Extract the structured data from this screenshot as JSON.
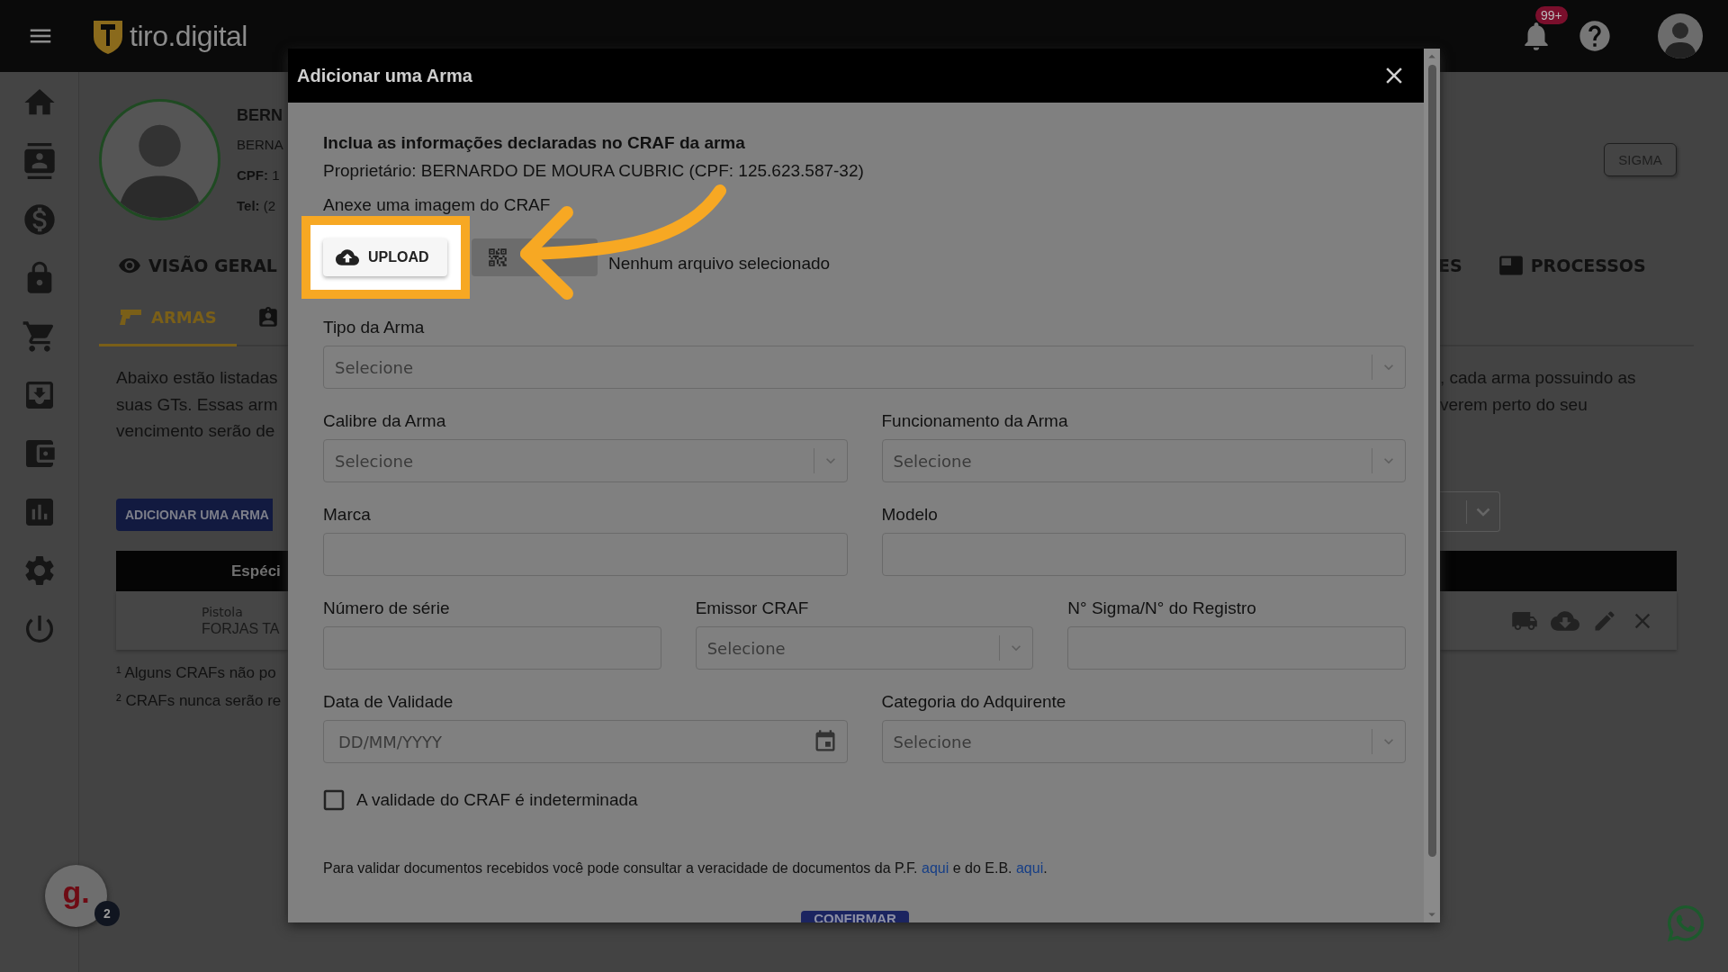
{
  "app": {
    "logo": "tiro.digital",
    "notifications_badge": "99+"
  },
  "profile": {
    "name": "BERN",
    "line_2": "BERNA",
    "cpf": "**CPF:** 1",
    "tel": "**Tel:** (2"
  },
  "sigma_button": "SIGMA",
  "tabs": [
    {
      "label": "VISÃO GERAL",
      "kind": "eye",
      "selected": false
    },
    {
      "label": "ES",
      "kind": "plain",
      "selected": false
    },
    {
      "label": "PROCESSOS",
      "kind": "panel",
      "selected": false
    }
  ],
  "subtabs": [
    {
      "label": "ARMAS",
      "selected": true
    }
  ],
  "description_left": [
    "Abaixo estão listadas",
    "suas GTs. Essas arm",
    "vencimento serão de"
  ],
  "description_right": [
    ", cada arma possuindo as",
    "verem perto do seu"
  ],
  "add_button": "ADICIONAR UMA ARMA",
  "table": {
    "columns": [
      "Espéci"
    ],
    "rows": [
      {
        "type": "Pistola",
        "brand": "FORJAS TA"
      }
    ]
  },
  "footnotes": [
    "¹ Alguns CRAFs não po",
    "² CRAFs nunca serão re"
  ],
  "chat": {
    "logo": "g.",
    "badge": "2"
  },
  "modal": {
    "title": "Adicionar uma Arma",
    "heading": "Inclua as informações declaradas no CRAF da arma",
    "owner": "Proprietário: BERNARDO DE MOURA CUBRIC (CPF: 125.623.587-32)",
    "attach_label": "Anexe uma imagem do CRAF",
    "upload_button": "UPLOAD",
    "file_status": "Nenhum arquivo selecionado",
    "field_rows": [
      [
        {
          "label": "Tipo da Arma",
          "kind": "select",
          "placeholder": "Selecione"
        }
      ],
      [
        {
          "label": "Calibre da Arma",
          "kind": "select",
          "placeholder": "Selecione"
        },
        {
          "label": "Funcionamento da Arma",
          "kind": "select",
          "placeholder": "Selecione"
        }
      ],
      [
        {
          "label": "Marca",
          "kind": "text"
        },
        {
          "label": "Modelo",
          "kind": "text"
        }
      ],
      [
        {
          "label": "Número de série",
          "kind": "text"
        },
        {
          "label": "Emissor CRAF",
          "kind": "select",
          "placeholder": "Selecione"
        },
        {
          "label": "N° Sigma/N° do Registro",
          "kind": "text"
        }
      ],
      [
        {
          "label": "Data de Validade",
          "kind": "date",
          "placeholder": "DD/MM/YYYY"
        },
        {
          "label": "Categoria do Adquirente",
          "kind": "select",
          "placeholder": "Selecione"
        }
      ]
    ],
    "checkbox": {
      "label": "A validade do CRAF é indeterminada",
      "checked": false
    },
    "note": [
      {
        "kind": "text",
        "text": "Para validar documentos recebidos você pode consultar a veracidade de documentos da P.F. "
      },
      {
        "kind": "link",
        "text": "aqui"
      },
      {
        "kind": "text",
        "text": " e do E.B. "
      },
      {
        "kind": "link",
        "text": "aqui"
      },
      {
        "kind": "text",
        "text": "."
      }
    ],
    "confirm_button": "CONFIRMAR"
  }
}
